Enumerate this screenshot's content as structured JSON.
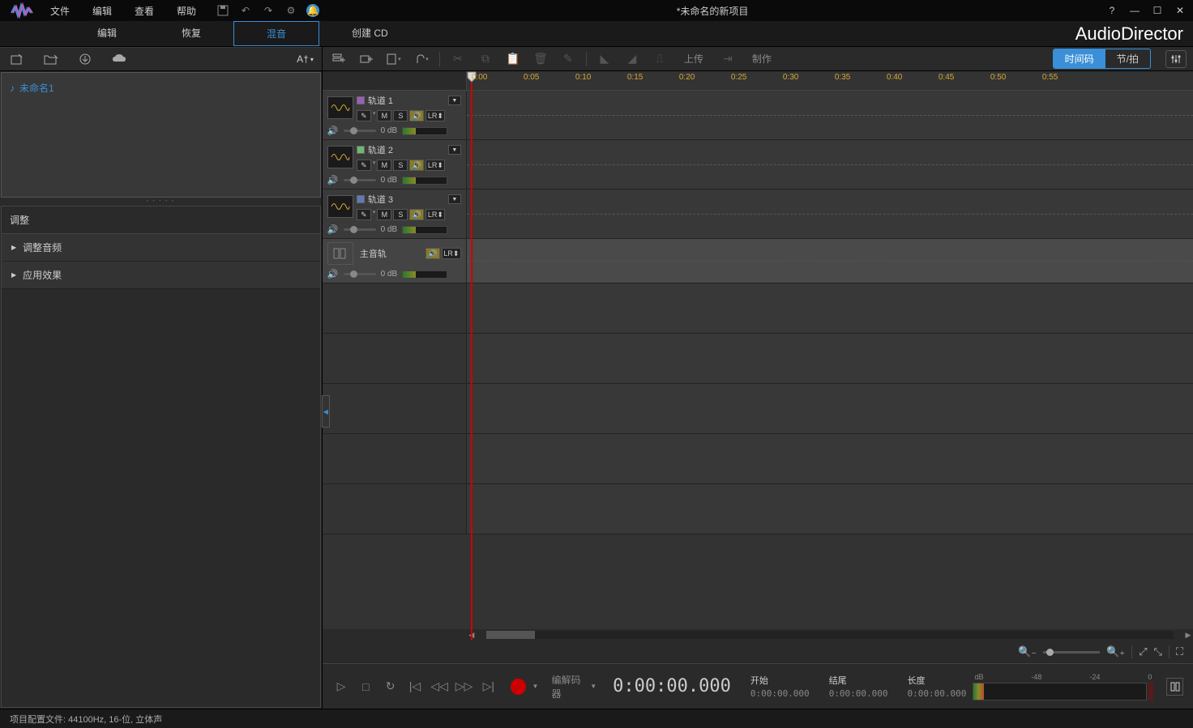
{
  "titlebar": {
    "menus": [
      "文件",
      "编辑",
      "查看",
      "帮助"
    ],
    "project_title": "*未命名的新项目"
  },
  "tabs": {
    "items": [
      "编辑",
      "恢复",
      "混音",
      "创建 CD"
    ],
    "active_index": 2
  },
  "brand": "AudioDirector",
  "library": {
    "sort_label": "A†",
    "items": [
      {
        "name": "未命名1"
      }
    ]
  },
  "adjust_panel": {
    "header": "调整",
    "sections": [
      "调整音频",
      "应用效果"
    ]
  },
  "timeline_toolbar": {
    "upload": "上传",
    "produce": "制作",
    "view_timecode": "时间码",
    "view_beat": "节/拍"
  },
  "ruler_ticks": [
    "0:00",
    "0:05",
    "0:10",
    "0:15",
    "0:20",
    "0:25",
    "0:30",
    "0:35",
    "0:40",
    "0:45",
    "0:50",
    "0:55"
  ],
  "tracks": [
    {
      "name": "轨道 1",
      "color": "#9a5fb8",
      "db": "0 dB",
      "mute": "M",
      "solo": "S",
      "lr": "LR⬍"
    },
    {
      "name": "轨道 2",
      "color": "#6fb86f",
      "db": "0 dB",
      "mute": "M",
      "solo": "S",
      "lr": "LR⬍"
    },
    {
      "name": "轨道 3",
      "color": "#5f7ab8",
      "db": "0 dB",
      "mute": "M",
      "solo": "S",
      "lr": "LR⬍"
    }
  ],
  "master_track": {
    "name": "主音轨",
    "db": "0 dB",
    "lr": "LR⬍"
  },
  "transport": {
    "codec_label": "编解码器",
    "timecode": "0:00:00.000",
    "start_label": "开始",
    "start_val": "0:00:00.000",
    "end_label": "结尾",
    "end_val": "0:00:00.000",
    "length_label": "长度",
    "length_val": "0:00:00.000",
    "meter_scale": [
      "dB",
      "-48",
      "-24",
      "0"
    ]
  },
  "statusbar": {
    "text": "项目配置文件: 44100Hz, 16-位, 立体声"
  }
}
